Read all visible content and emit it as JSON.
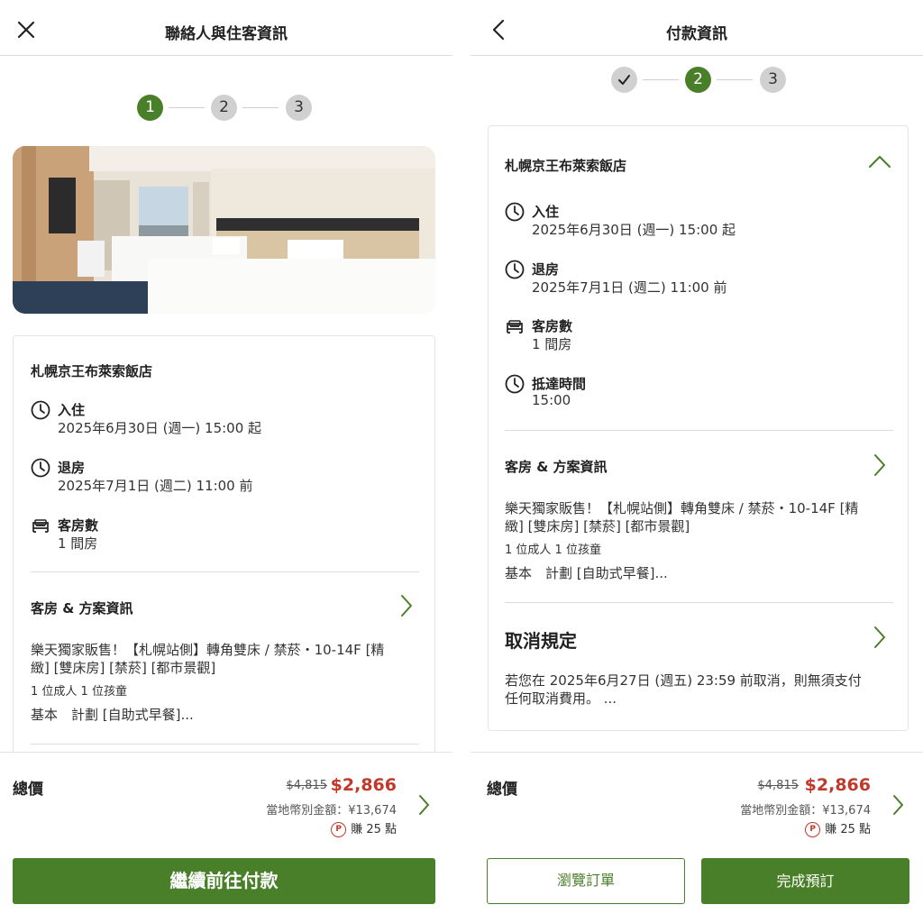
{
  "left": {
    "title": "聯絡人與住客資訊",
    "steps": [
      "1",
      "2",
      "3"
    ],
    "hotel_name": "札幌京王布萊索飯店",
    "checkin_label": "入住",
    "checkin_value": "2025年6月30日 (週一) 15:00 起",
    "checkout_label": "退房",
    "checkout_value": "2025年7月1日 (週二) 11:00 前",
    "rooms_label": "客房數",
    "rooms_value": "1 間房",
    "room_plan_heading": "客房 & 方案資訊",
    "room_desc_1": "樂天獨家販售！【札幌站側】轉角雙床 / 禁菸・10-14F [精",
    "room_desc_2": "緻] [雙床房] [禁菸] [都市景觀]",
    "guests": "1 位成人 1 位孩童",
    "plan": "基本　計劃 [自助式早餐]...",
    "total_label": "總價",
    "old_price": "$4,815",
    "new_price": "$2,866",
    "local_amount": "當地幣別金額：¥13,674",
    "points_badge": "P",
    "points": "賺 25 點",
    "continue_button": "繼續前往付款"
  },
  "right": {
    "title": "付款資訊",
    "steps": [
      "✓",
      "2",
      "3"
    ],
    "hotel_name": "札幌京王布萊索飯店",
    "checkin_label": "入住",
    "checkin_value": "2025年6月30日 (週一) 15:00 起",
    "checkout_label": "退房",
    "checkout_value": "2025年7月1日 (週二) 11:00 前",
    "rooms_label": "客房數",
    "rooms_value": "1 間房",
    "arrival_label": "抵達時間",
    "arrival_value": "15:00",
    "room_plan_heading": "客房 & 方案資訊",
    "room_desc_1": "樂天獨家販售！【札幌站側】轉角雙床 / 禁菸・10-14F [精",
    "room_desc_2": "緻] [雙床房] [禁菸] [都市景觀]",
    "guests": "1 位成人 1 位孩童",
    "plan": "基本　計劃 [自助式早餐]...",
    "cancel_heading": "取消規定",
    "cancel_text_1": "若您在 2025年6月27日 (週五) 23:59 前取消，則無須支付",
    "cancel_text_2": "任何取消費用。 ...",
    "total_label": "總價",
    "old_price": "$4,815",
    "new_price": "$2,866",
    "local_amount": "當地幣別金額：¥13,674",
    "points_badge": "P",
    "points": "賺 25 點",
    "browse_button": "瀏覽訂單",
    "complete_button": "完成預訂"
  },
  "colors": {
    "brand_green": "#4a7f2a",
    "price_red": "#c0392b",
    "step_inactive": "#d0d0d0"
  },
  "icons": [
    "close-icon",
    "back-icon",
    "clock-icon",
    "bed-icon",
    "chevron-right-icon",
    "chevron-up-icon",
    "check-icon",
    "points-icon"
  ]
}
